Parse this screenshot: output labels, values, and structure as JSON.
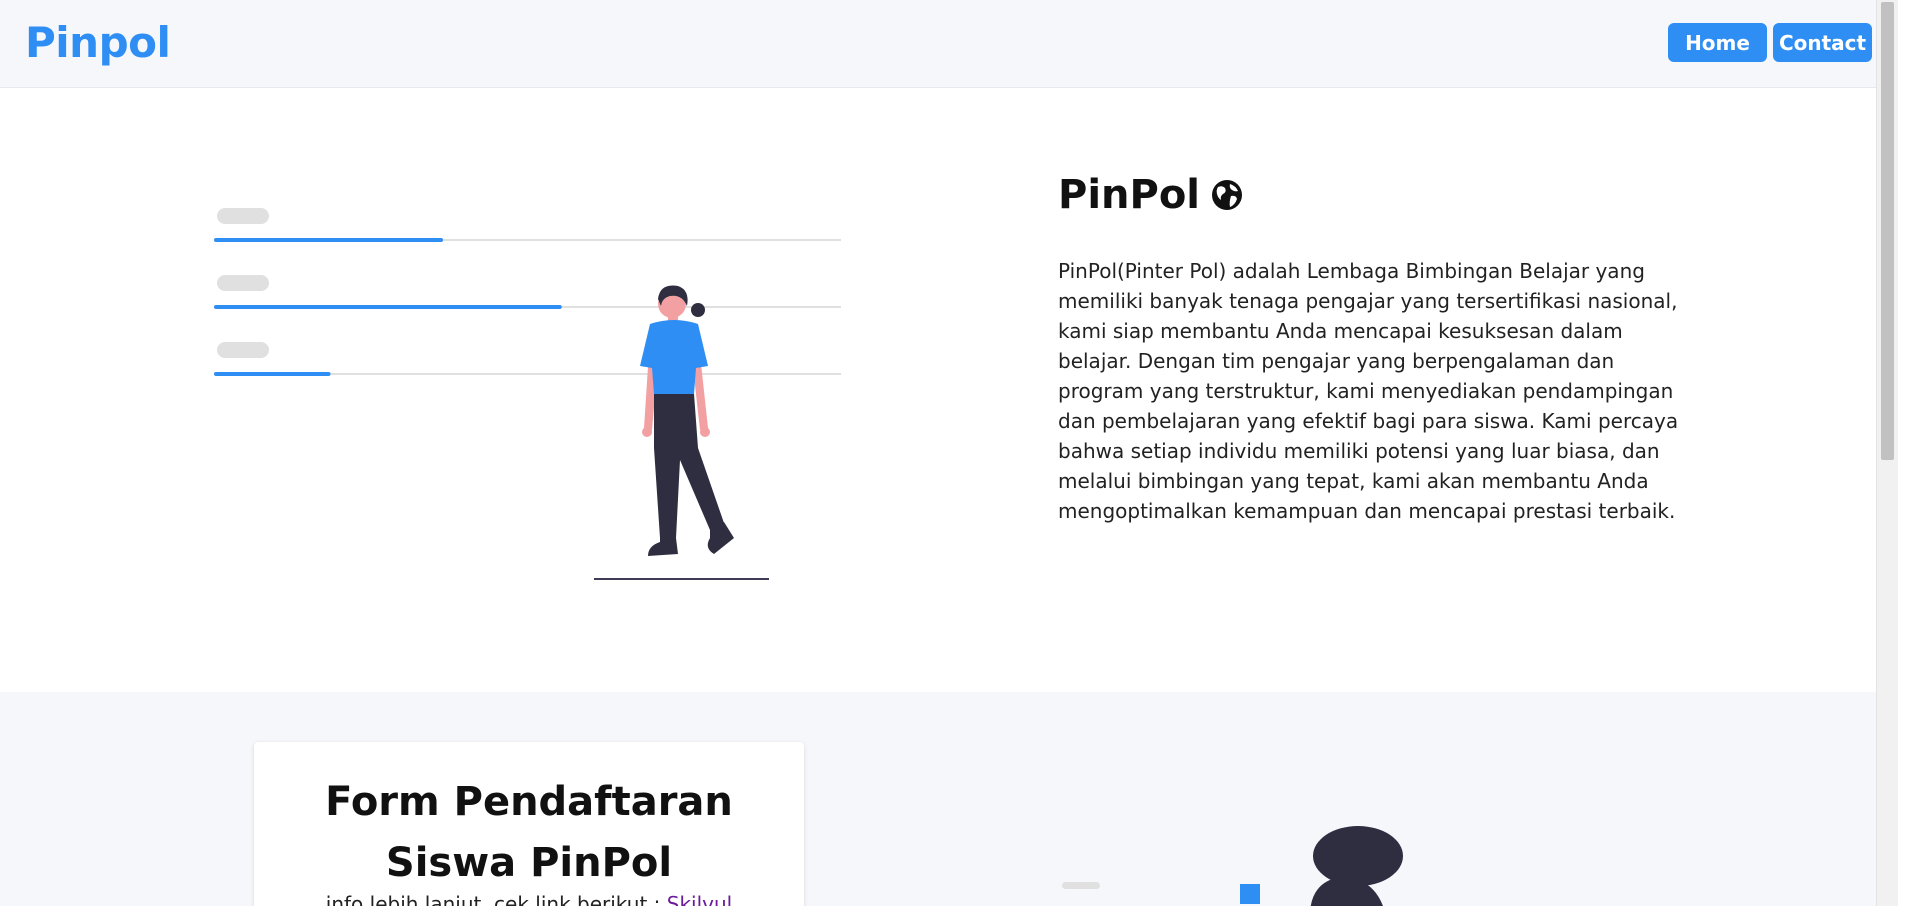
{
  "brand": {
    "name": "Pinpol",
    "color": "#2f8ef4"
  },
  "nav": {
    "home_label": "Home",
    "contact_label": "Contact"
  },
  "hero": {
    "title": "PinPol",
    "title_icon": "globe-icon",
    "description": "PinPol(Pinter Pol) adalah Lembaga Bimbingan Belajar yang memiliki banyak tenaga pengajar yang tersertifikasi nasional, kami siap membantu Anda mencapai kesuksesan dalam belajar. Dengan tim pengajar yang berpengalaman dan program yang terstruktur, kami menyediakan pendampingan dan pembelajaran yang efektif bagi para siswa. Kami percaya bahwa setiap individu memiliki potensi yang luar biasa, dan melalui bimbingan yang tepat, kami akan membantu Anda mengoptimalkan kemampuan dan mencapai prestasi terbaik.",
    "illustration": {
      "progress_fractions": [
        0.36,
        0.55,
        0.18
      ]
    }
  },
  "form": {
    "title": "Form Pendaftaran Siswa PinPol",
    "info_prefix": "info lebih lanjut, cek link berikut :",
    "info_link": "Skilvul"
  },
  "colors": {
    "accent": "#2f8ef4",
    "header_bg": "#f5f7fb",
    "section_bg": "#f5f7fb",
    "figure_dark": "#2f2e41",
    "skin": "#f2a0a1",
    "track": "#e0e0e0"
  }
}
